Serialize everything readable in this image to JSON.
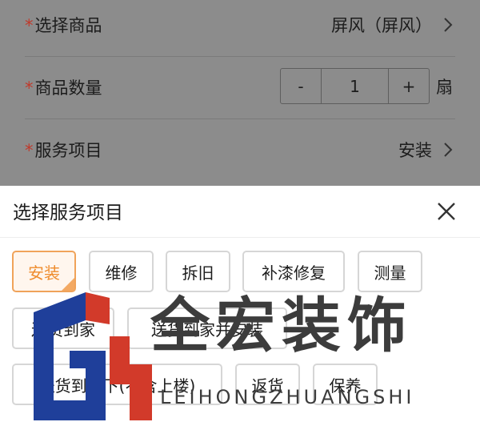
{
  "form": {
    "required_mark": "*",
    "product": {
      "label": "选择商品",
      "value": "屏风（屏风）"
    },
    "quantity": {
      "label": "商品数量",
      "minus": "-",
      "value": "1",
      "plus": "+",
      "unit": "扇"
    },
    "service": {
      "label": "服务项目",
      "value": "安装"
    }
  },
  "sheet": {
    "title": "选择服务项目",
    "options": [
      {
        "label": "安装",
        "selected": true
      },
      {
        "label": "维修",
        "selected": false
      },
      {
        "label": "拆旧",
        "selected": false
      },
      {
        "label": "补漆修复",
        "selected": false
      },
      {
        "label": "测量",
        "selected": false
      },
      {
        "label": "送货到家",
        "selected": false
      },
      {
        "label": "送货到家并安装",
        "selected": false
      },
      {
        "label": "送货到楼下(不含上楼)",
        "selected": false
      },
      {
        "label": "返货",
        "selected": false
      },
      {
        "label": "保养",
        "selected": false
      }
    ]
  },
  "watermark": {
    "name": "全宏装饰",
    "pinyin": "LEIHONGZHUANGSHI"
  },
  "colors": {
    "accent": "#ef8c2d",
    "required": "#c0392b",
    "overlay": "#8c8c8c"
  }
}
